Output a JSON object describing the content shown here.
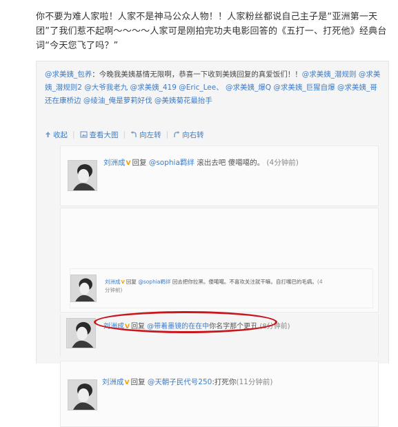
{
  "post": {
    "text_part1": "你不要为难人家啦！人家不是神马公众人物！！人家粉丝都说自己主子是",
    "text_quote": "“亚洲第一天团”",
    "text_part2": "了我们惹不起啊～～～～人家可是刚拍完功夫电影回答的《五打一、打死他》经典台词",
    "text_quote2": "“今天您飞了吗？”"
  },
  "quote": {
    "author": "@求美姨_包养",
    "body": "：今晚我美姨基情无限啊，恭喜一下收到美姨回复的真爱饭们！！",
    "mentions": "@求美姨_潜规则 @求美姨_潜规则2 @大爷我老九 @求美姨_419 @Eric_Lee、 @求美姨_爆Q @求美姨_巨猩自爆 @求美姨_哥还在康桥边 @绫油_俺是萝莉好伐 @美姨菊花最抬手"
  },
  "toolbar": {
    "collapse": "收起",
    "view_large": "查看大图",
    "rotate_left": "向左转",
    "rotate_right": "向右转"
  },
  "comments": [
    {
      "name": "刘洲成",
      "reply_label": "回复",
      "mention": "@sophia羁绊",
      "text": "滚出去吧 傻噶噶的。",
      "time": "(4分钟前)"
    },
    {
      "name": "刘洲成",
      "reply_label": "回复",
      "mention": "@sophia羁绊",
      "text": "回去把你拉黑。傻噶噶。不喜欢关注就干嘛。自打嘴巴的毛病。",
      "time": "(4分钟前)"
    },
    {
      "name": "刘洲成",
      "reply_label": "回复",
      "mention": "@带着墨镜的在在中",
      "text": "你名字那个更丑",
      "time": "(8分钟前)"
    },
    {
      "name": "刘洲成",
      "reply_label": "回复",
      "mention": "@天朝子民代号250",
      "text": ":打死你",
      "time": "(11分钟前)"
    }
  ],
  "colors": {
    "link": "#3d7cc7",
    "highlight_ring": "#c8181e",
    "vip_badge": "#f0a000"
  },
  "icons": [
    "collapse-icon",
    "view-large-icon",
    "rotate-left-icon",
    "rotate-right-icon",
    "vip-badge-icon",
    "avatar"
  ]
}
